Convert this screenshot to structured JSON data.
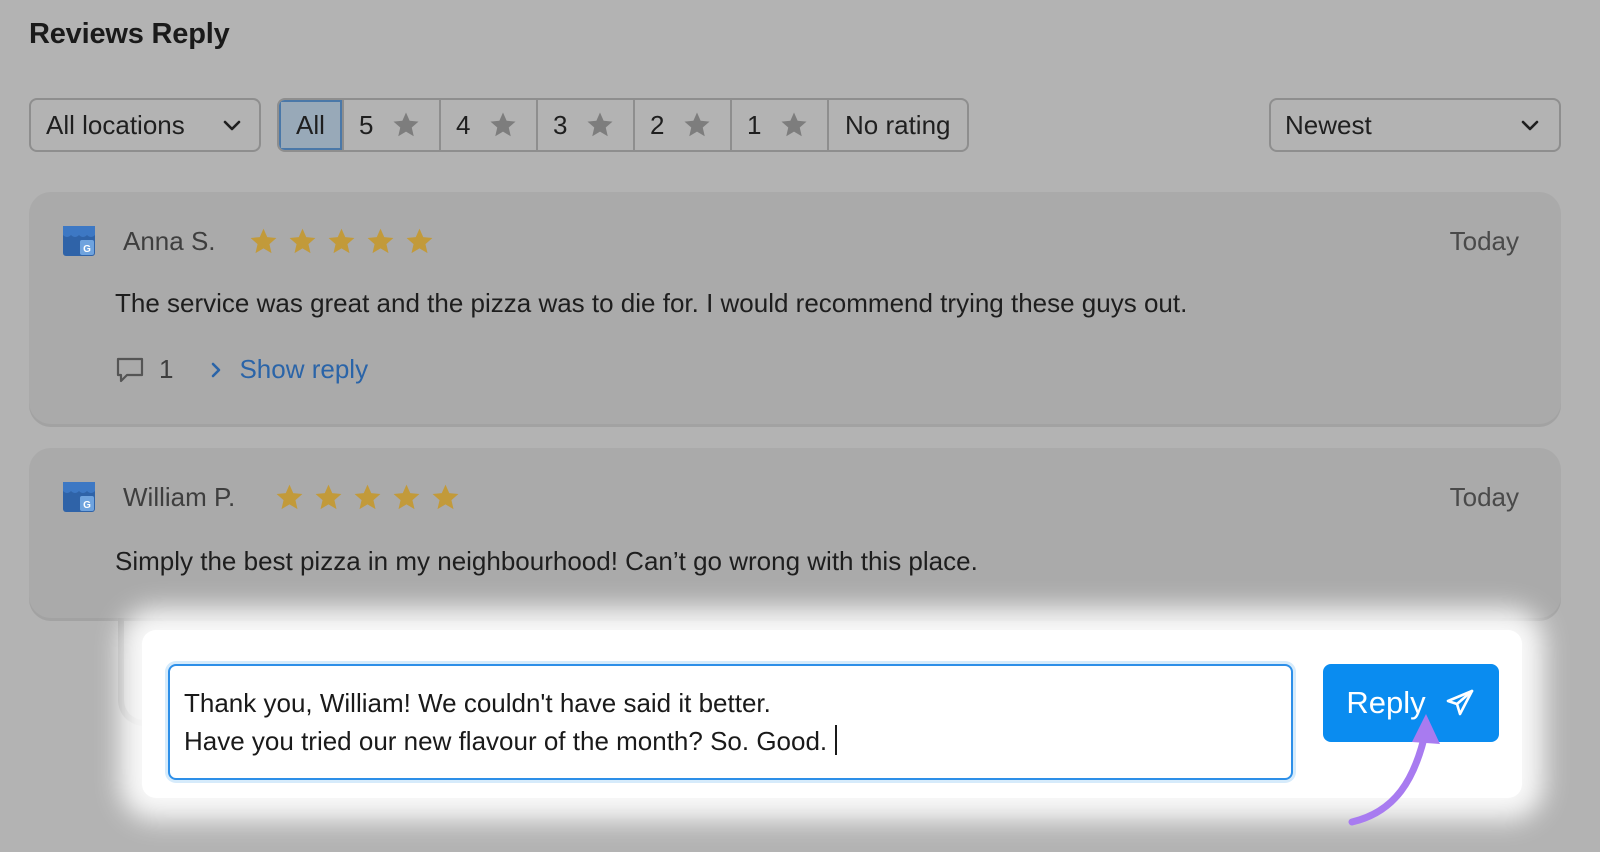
{
  "page": {
    "title": "Reviews Reply"
  },
  "filters": {
    "location": {
      "selected": "All locations"
    },
    "ratings": [
      {
        "label": "All",
        "active": true,
        "has_star": false
      },
      {
        "label": "5",
        "active": false,
        "has_star": true
      },
      {
        "label": "4",
        "active": false,
        "has_star": true
      },
      {
        "label": "3",
        "active": false,
        "has_star": true
      },
      {
        "label": "2",
        "active": false,
        "has_star": true
      },
      {
        "label": "1",
        "active": false,
        "has_star": true
      },
      {
        "label": "No rating",
        "active": false,
        "has_star": false
      }
    ],
    "sort": {
      "selected": "Newest"
    }
  },
  "reviews": [
    {
      "author": "Anna S.",
      "rating": 5,
      "date": "Today",
      "text": "The service was great and the pizza was to die for. I would recommend trying these guys out.",
      "reply_count": "1",
      "show_reply_label": "Show reply",
      "source_icon": "google-business-icon"
    },
    {
      "author": "William P.",
      "rating": 5,
      "date": "Today",
      "text": "Simply the best pizza in my neighbourhood! Can’t go wrong with this place.",
      "source_icon": "google-business-icon"
    }
  ],
  "reply_editor": {
    "lines": [
      "Thank you, William! We couldn't have said it better.",
      "Have you tried our new flavour of the month? So. Good."
    ],
    "button_label": "Reply",
    "button_icon": "send-icon"
  },
  "colors": {
    "star": "#c29a3a",
    "link": "#2a64a8",
    "primary": "#0a8cf0",
    "pointer": "#a87bf0"
  }
}
